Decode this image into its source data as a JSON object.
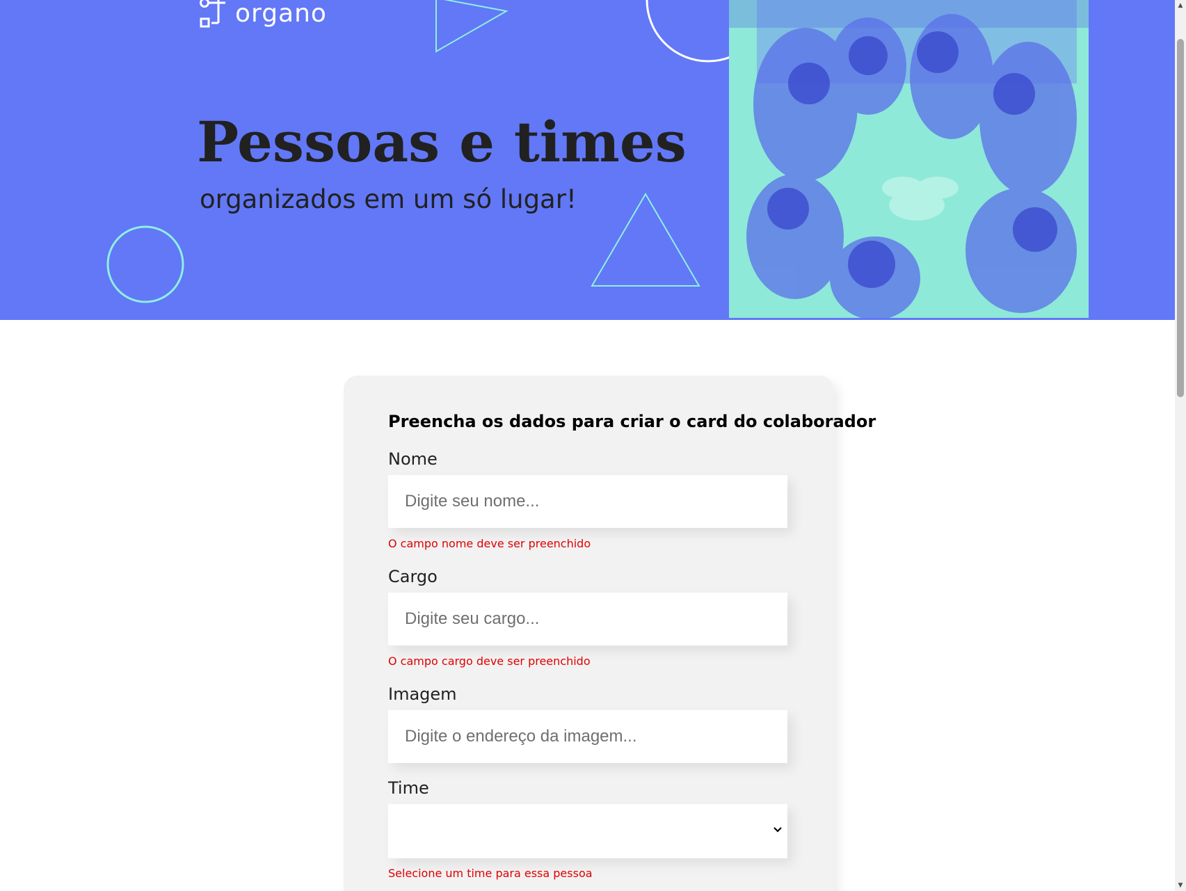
{
  "header": {
    "logo_text": "organo",
    "title": "Pessoas e times",
    "subtitle": "organizados em um só lugar!",
    "banner_color": "#6278f7",
    "photo_tint": "#8ee9d8",
    "shape_light_color": "#ffffff",
    "shape_teal_color": "#8ff0e0"
  },
  "form": {
    "title": "Preencha os dados para criar o card do colaborador",
    "fields": {
      "nome": {
        "label": "Nome",
        "placeholder": "Digite seu nome...",
        "value": "",
        "error": "O campo nome deve ser preenchido"
      },
      "cargo": {
        "label": "Cargo",
        "placeholder": "Digite seu cargo...",
        "value": "",
        "error": "O campo cargo deve ser preenchido"
      },
      "imagem": {
        "label": "Imagem",
        "placeholder": "Digite o endereço da imagem...",
        "value": ""
      },
      "time": {
        "label": "Time",
        "selected": "",
        "error": "Selecione um time para essa pessoa"
      }
    },
    "error_color": "#e00000"
  },
  "scrollbar": {
    "up_icon": "arrow-up-icon",
    "down_icon": "arrow-down-icon"
  }
}
